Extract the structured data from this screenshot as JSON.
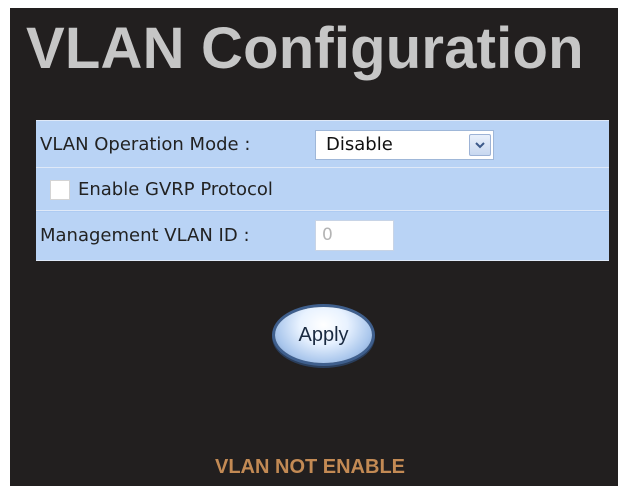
{
  "page": {
    "title": "VLAN Configuration"
  },
  "form": {
    "mode_label": "VLAN Operation Mode :",
    "mode_value": "Disable",
    "gvrp_label": "Enable GVRP Protocol",
    "gvrp_checked": false,
    "mgmt_label": "Management VLAN ID :",
    "mgmt_value": "0"
  },
  "actions": {
    "apply_label": "Apply"
  },
  "status": {
    "text": "VLAN NOT ENABLE"
  },
  "colors": {
    "background": "#221f1f",
    "title": "#c6c6c6",
    "form_row": "#b9d3f5",
    "status_text": "#c38a54"
  }
}
